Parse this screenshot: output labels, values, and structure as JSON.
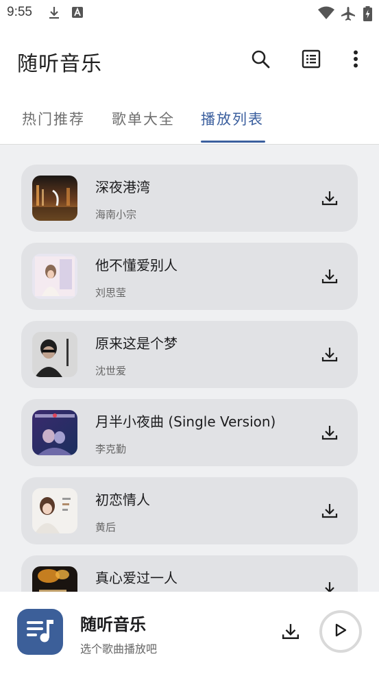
{
  "status_bar": {
    "time": "9:55",
    "icons": [
      "download-icon",
      "notification-a-icon",
      "wifi-icon",
      "airplane-icon",
      "battery-charging-icon"
    ]
  },
  "app_bar": {
    "title": "随听音乐",
    "actions": [
      "search-icon",
      "list-icon",
      "more-vert-icon"
    ]
  },
  "tabs": [
    {
      "label": "热门推荐",
      "active": false
    },
    {
      "label": "歌单大全",
      "active": false
    },
    {
      "label": "播放列表",
      "active": true
    }
  ],
  "songs": [
    {
      "title": "深夜港湾",
      "artist": "海南小宗"
    },
    {
      "title": "他不懂爱别人",
      "artist": "刘思莹"
    },
    {
      "title": "原来这是个梦",
      "artist": "沈世爱"
    },
    {
      "title": "月半小夜曲 (Single Version)",
      "artist": "李克勤"
    },
    {
      "title": "初恋情人",
      "artist": "黄后"
    },
    {
      "title": "真心爱过一人",
      "artist": ""
    }
  ],
  "player": {
    "title": "随听音乐",
    "subtitle": "选个歌曲播放吧"
  },
  "colors": {
    "accent": "#3b5f9e",
    "card": "#e1e2e5",
    "list_bg": "#eff0f2"
  }
}
